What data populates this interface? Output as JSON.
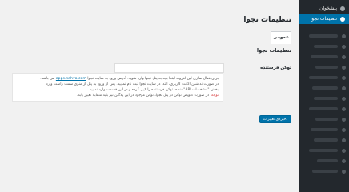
{
  "sidebar": {
    "items": [
      {
        "label": "پیشخوان",
        "icon": "dashboard-icon"
      },
      {
        "label": "تنظیمات نجوا",
        "icon": "bell-icon",
        "active": true
      }
    ],
    "placeholder_icons": [
      "menu-icon"
    ]
  },
  "page": {
    "title": "تنظیمات نجوا",
    "tabs": [
      {
        "label": "عمومی"
      }
    ],
    "section_title": "تنظیمات نجوا"
  },
  "form": {
    "sender_label": "توکن فرستنده",
    "sender_value": "",
    "help": {
      "line1_before": "برای فعال سازی این افزونه ابتدا باید به پنل نجوا وارد شوید. آدرس ورود به سایت نجوا",
      "link": "apps.nahva.com",
      "line1_after": "می باشد.",
      "line2": "در صورت نداشتن اکانت کاربری، ابتدا در سایت نجوا ثبت نام نمایید. پس از ورود به پنل از منوی سمت راست وارد",
      "line3": "بخش \"مشخصات API\" شده، توکن فرستنده را کپی کرده و در این قسمت وارد نمایید.",
      "note_label": "توجه:",
      "note_text": "در صورت تعویض توکن در پنل نجوا، توکن موجود در این پلاگین نیز باید متقابلا تغییر یابد."
    },
    "save_label": "ذخیره‌ی تغییرات"
  }
}
